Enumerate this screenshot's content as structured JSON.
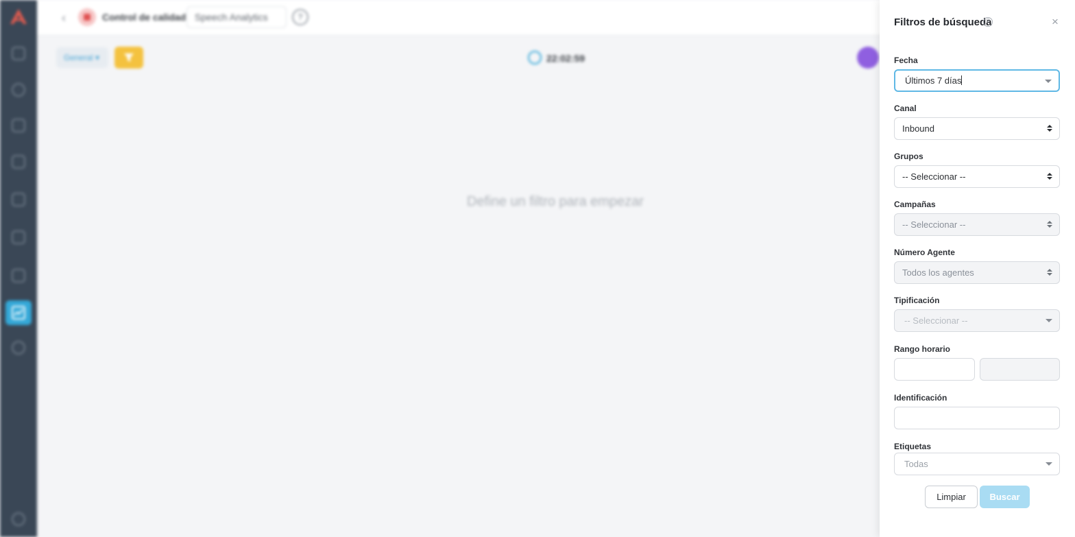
{
  "topbar": {
    "title": "Control de calidad",
    "module": "Speech Analytics",
    "help": "?"
  },
  "toolbar": {
    "general_label": "General",
    "clock_time": "22:02:59"
  },
  "main": {
    "empty_message": "Define un filtro para empezar"
  },
  "panel": {
    "title": "Filtros de búsqueda",
    "help": "?",
    "close": "×",
    "fields": {
      "fecha": {
        "label": "Fecha",
        "value": "Últimos 7 días"
      },
      "canal": {
        "label": "Canal",
        "value": "Inbound"
      },
      "grupos": {
        "label": "Grupos",
        "value": "-- Seleccionar --"
      },
      "campanas": {
        "label": "Campañas",
        "value": "-- Seleccionar --"
      },
      "numero_agente": {
        "label": "Número Agente",
        "value": "Todos los agentes"
      },
      "tipificacion": {
        "label": "Tipificación",
        "value": "-- Seleccionar --"
      },
      "rango_horario": {
        "label": "Rango horario"
      },
      "identificacion": {
        "label": "Identificación",
        "value": ""
      },
      "etiquetas": {
        "label": "Etiquetas",
        "placeholder": "Todas"
      }
    },
    "clear_label": "Limpiar",
    "search_label": "Buscar"
  },
  "colors": {
    "sidebar": "#3a4756",
    "accent": "#34a8d8",
    "filter_button": "#f4c23f",
    "search_button": "#a9dcf3"
  }
}
